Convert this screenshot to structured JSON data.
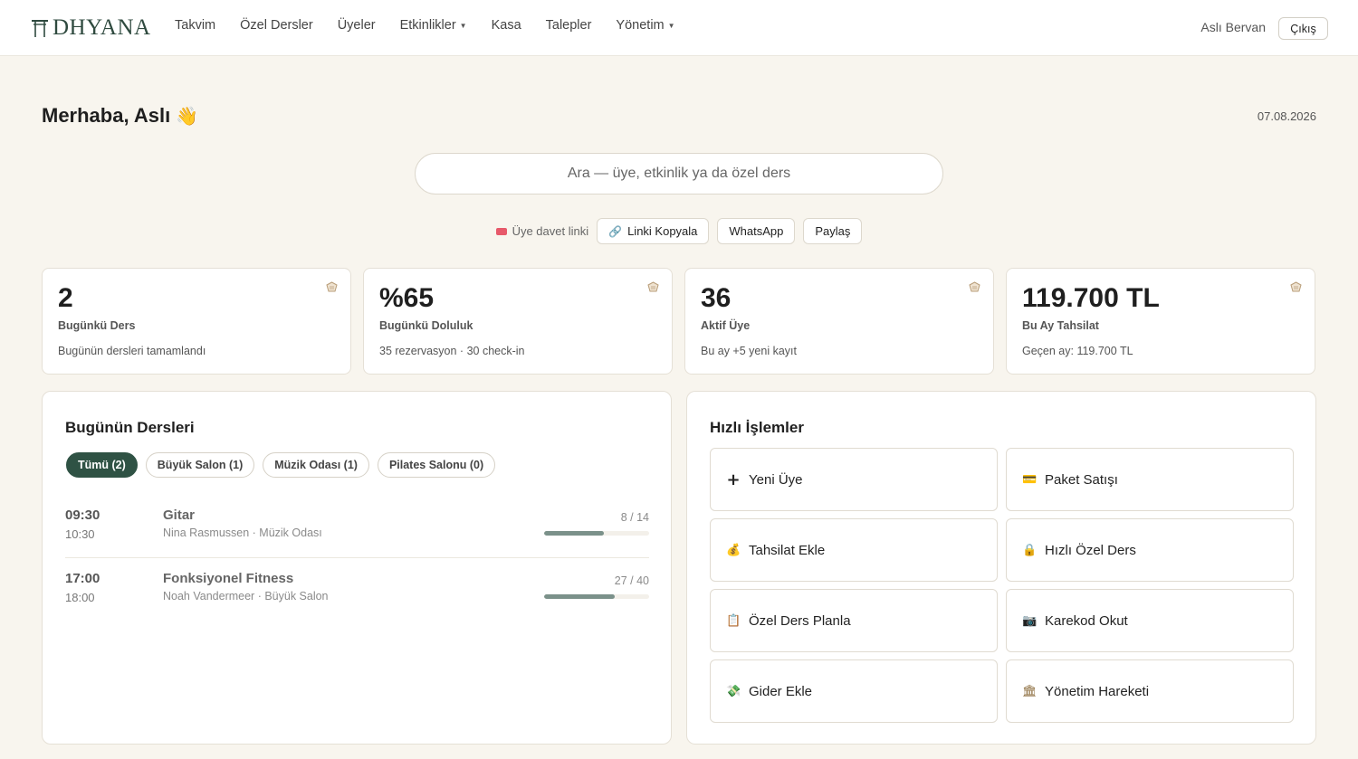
{
  "brand": {
    "name": "DHYANA"
  },
  "nav": [
    {
      "label": "Takvim",
      "dropdown": false
    },
    {
      "label": "Özel Dersler",
      "dropdown": false
    },
    {
      "label": "Üyeler",
      "dropdown": false
    },
    {
      "label": "Etkinlikler",
      "dropdown": true
    },
    {
      "label": "Kasa",
      "dropdown": false
    },
    {
      "label": "Talepler",
      "dropdown": false
    },
    {
      "label": "Yönetim",
      "dropdown": true
    }
  ],
  "user": {
    "name": "Aslı Bervan",
    "logout_label": "Çıkış"
  },
  "greeting": {
    "text": "Merhaba, Aslı",
    "emoji": "👋"
  },
  "date": "07.08.2026",
  "search": {
    "placeholder": "Ara — üye, etkinlik ya da özel ders",
    "value": ""
  },
  "invite": {
    "label": "Üye davet linki",
    "copy_label": "Linki Kopyala",
    "whatsapp_label": "WhatsApp",
    "share_label": "Paylaş"
  },
  "stats": [
    {
      "value": "2",
      "label": "Bugünkü Ders",
      "sub": "Bugünün dersleri tamamlandı"
    },
    {
      "value": "%65",
      "label": "Bugünkü Doluluk",
      "sub": "35 rezervasyon · 30 check-in"
    },
    {
      "value": "36",
      "label": "Aktif Üye",
      "sub": "Bu ay +5 yeni kayıt"
    },
    {
      "value": "119.700 TL",
      "label": "Bu Ay Tahsilat",
      "sub": "Geçen ay: 119.700 TL"
    }
  ],
  "today": {
    "title": "Bugünün Dersleri",
    "filters": [
      {
        "label": "Tümü (2)",
        "active": true
      },
      {
        "label": "Büyük Salon (1)",
        "active": false
      },
      {
        "label": "Müzik Odası (1)",
        "active": false
      },
      {
        "label": "Pilates Salonu (0)",
        "active": false
      }
    ],
    "lessons": [
      {
        "start": "09:30",
        "end": "10:30",
        "name": "Gitar",
        "meta": "Nina Rasmussen · Müzik Odası",
        "count": "8 / 14",
        "booked": 8,
        "capacity": 14
      },
      {
        "start": "17:00",
        "end": "18:00",
        "name": "Fonksiyonel Fitness",
        "meta": "Noah Vandermeer · Büyük Salon",
        "count": "27 / 40",
        "booked": 27,
        "capacity": 40
      }
    ]
  },
  "quick": {
    "title": "Hızlı İşlemler",
    "actions": [
      {
        "label": "Yeni Üye",
        "icon": "plus-icon",
        "glyph": "+"
      },
      {
        "label": "Paket Satışı",
        "icon": "credit-card-icon",
        "glyph": "💳"
      },
      {
        "label": "Tahsilat Ekle",
        "icon": "money-bag-icon",
        "glyph": "💰"
      },
      {
        "label": "Hızlı Özel Ders",
        "icon": "lock-icon",
        "glyph": "🔒"
      },
      {
        "label": "Özel Ders Planla",
        "icon": "clipboard-icon",
        "glyph": "📋"
      },
      {
        "label": "Karekod Okut",
        "icon": "camera-icon",
        "glyph": "📷"
      },
      {
        "label": "Gider Ekle",
        "icon": "money-wings-icon",
        "glyph": "💸"
      },
      {
        "label": "Yönetim Hareketi",
        "icon": "bank-icon",
        "glyph": "🏛"
      }
    ]
  }
}
